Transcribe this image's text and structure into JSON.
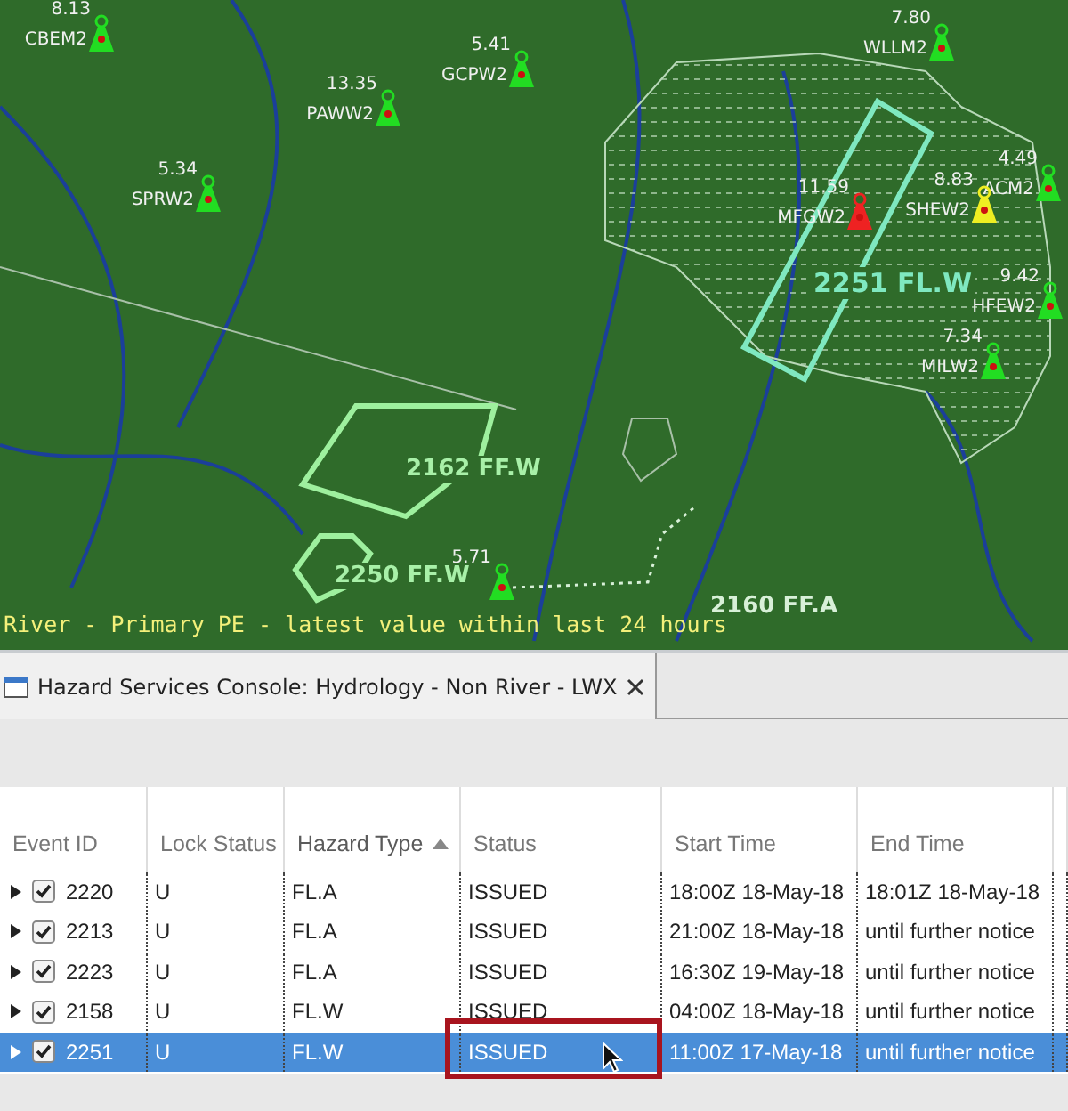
{
  "map": {
    "stations": [
      {
        "value": "8.13",
        "id": "CBEM2",
        "color": "#22dd22"
      },
      {
        "value": "5.41",
        "id": "GCPW2",
        "color": "#22dd22"
      },
      {
        "value": "13.35",
        "id": "PAWW2",
        "color": "#22dd22"
      },
      {
        "value": "5.34",
        "id": "SPRW2",
        "color": "#22dd22"
      },
      {
        "value": "7.80",
        "id": "WLLM2",
        "color": "#22dd22"
      },
      {
        "value": "4.49",
        "id": "ACM2",
        "color": "#22dd22"
      },
      {
        "value": "11.59",
        "id": "MFGW2",
        "color": "#ee2222"
      },
      {
        "value": "8.83",
        "id": "SHEW2",
        "color": "#eeee22"
      },
      {
        "value": "9.42",
        "id": "HFEW2",
        "color": "#22dd22"
      },
      {
        "value": "7.34",
        "id": "MILW2",
        "color": "#22dd22"
      },
      {
        "value": "5.71",
        "color": "#22dd22"
      }
    ],
    "hazards": [
      {
        "label": "2251 FL.W",
        "kind": "box"
      },
      {
        "label": "2162 FF.W",
        "kind": "polygon"
      },
      {
        "label": "2250 FF.W",
        "kind": "small"
      },
      {
        "label": "2160 FF.A",
        "kind": "dashed"
      }
    ],
    "status_line": "River - Primary PE - latest value within last 24 hours"
  },
  "console": {
    "tab": "Hazard Services Console: Hydrology - Non River - LWX",
    "columns": [
      {
        "label": "Event ID",
        "sorted": false
      },
      {
        "label": "Lock Status",
        "sorted": false
      },
      {
        "label": "Hazard Type",
        "sorted": true
      },
      {
        "label": "Status",
        "sorted": false
      },
      {
        "label": "Start Time",
        "sorted": false
      },
      {
        "label": "End Time",
        "sorted": false
      }
    ],
    "rows": [
      {
        "event_id": "2220",
        "lock": "U",
        "type": "FL.A",
        "status": "ISSUED",
        "start": "18:00Z 18-May-18",
        "end": "18:01Z 18-May-18",
        "checked": true,
        "selected": false,
        "outlined": false
      },
      {
        "event_id": "2213",
        "lock": "U",
        "type": "FL.A",
        "status": "ISSUED",
        "start": "21:00Z 18-May-18",
        "end": "until further notice",
        "checked": true,
        "selected": false,
        "outlined": false
      },
      {
        "event_id": "2223",
        "lock": "U",
        "type": "FL.A",
        "status": "ISSUED",
        "start": "16:30Z 19-May-18",
        "end": "until further notice",
        "checked": true,
        "selected": false,
        "outlined": false
      },
      {
        "event_id": "2158",
        "lock": "U",
        "type": "FL.W",
        "status": "ISSUED",
        "start": "04:00Z 18-May-18",
        "end": "until further notice",
        "checked": true,
        "selected": false,
        "outlined": false
      },
      {
        "event_id": "2251",
        "lock": "U",
        "type": "FL.W",
        "status": "ISSUED",
        "start": "11:00Z 17-May-18",
        "end": "until further notice",
        "checked": true,
        "selected": true,
        "outlined": true
      }
    ]
  }
}
